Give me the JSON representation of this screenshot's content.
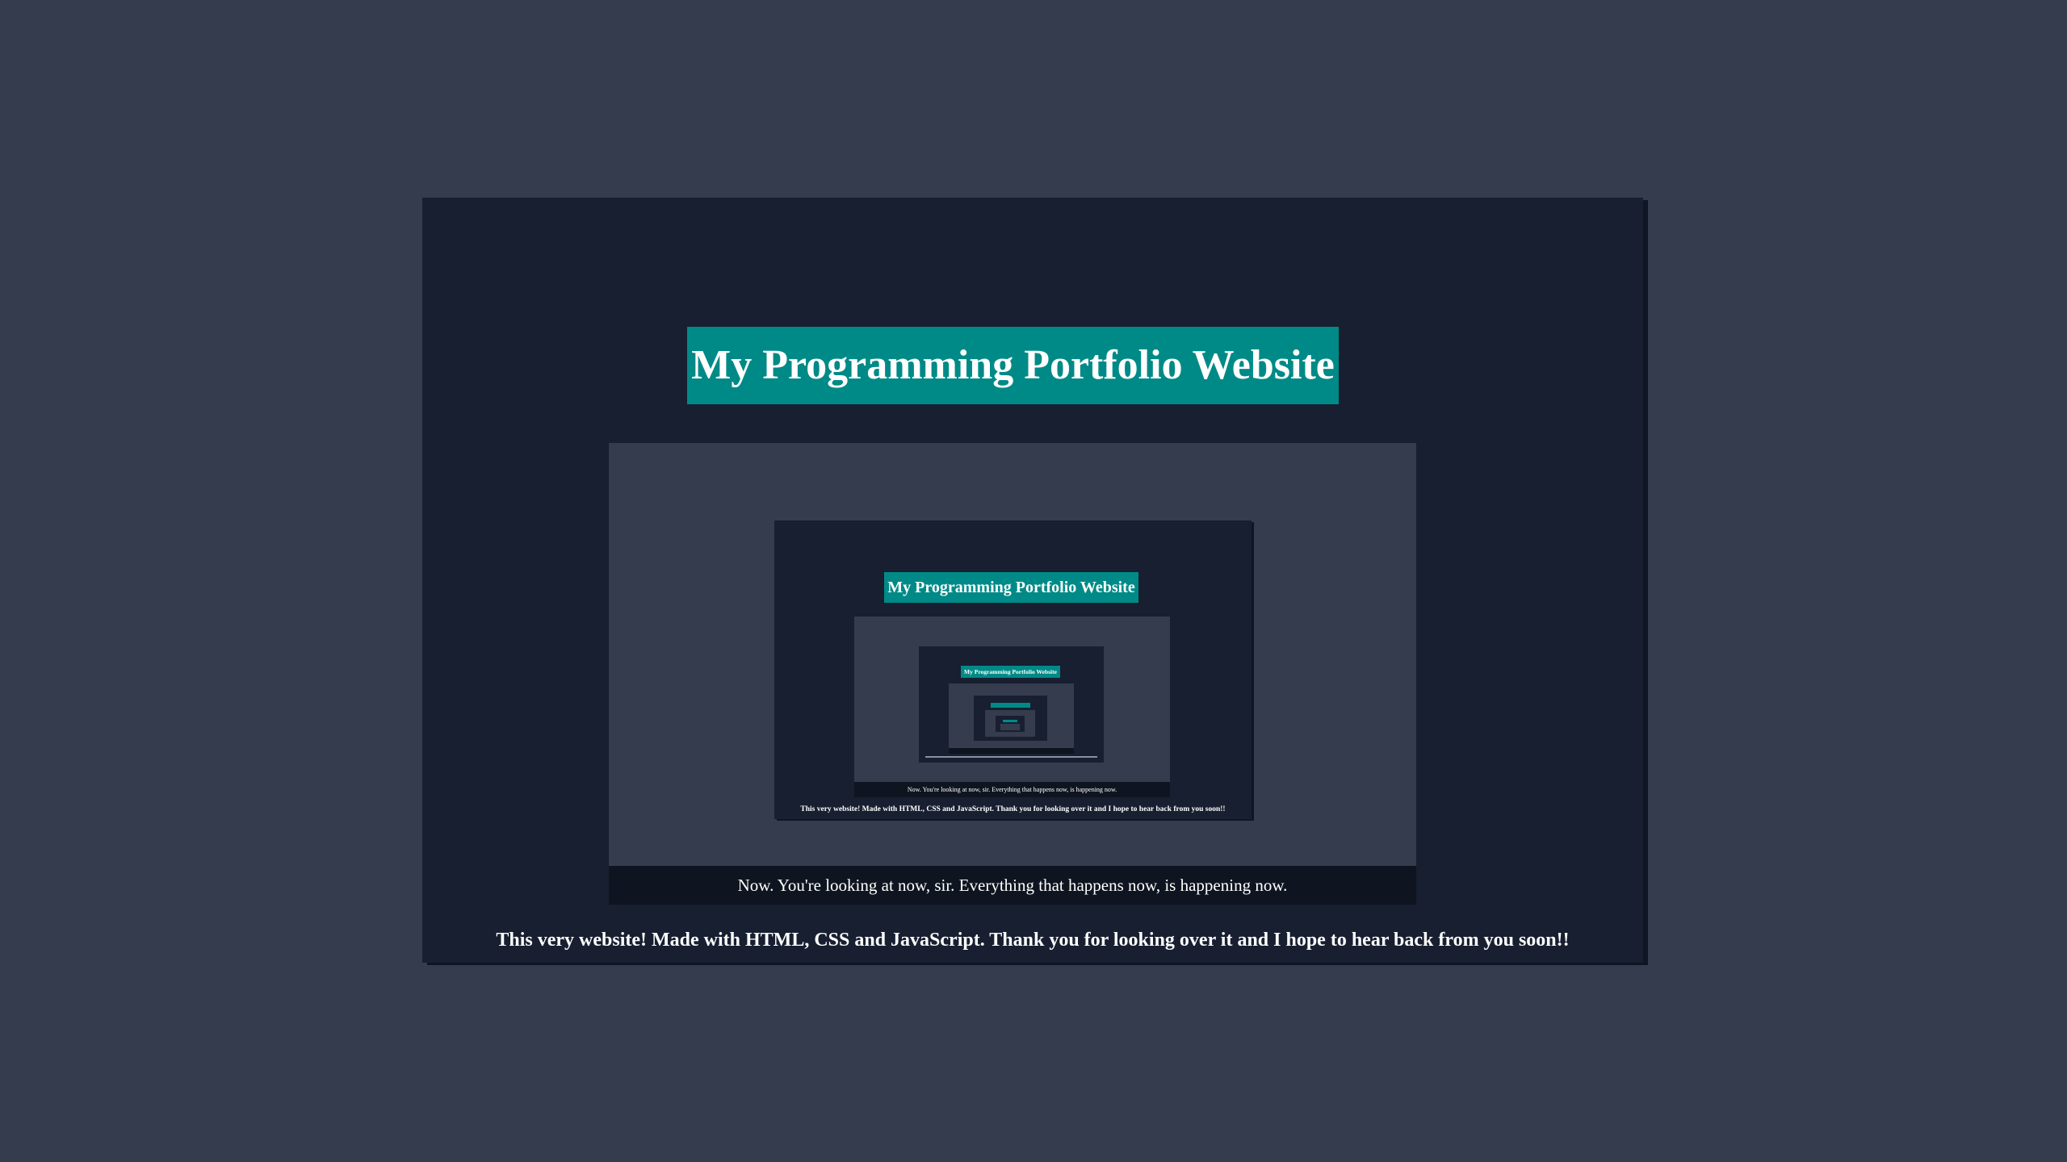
{
  "page": {
    "title": "My Programming Portfolio Website",
    "caption": "Now. You're looking at now, sir. Everything that happens now, is happening now.",
    "footer": "This very website! Made with HTML, CSS and JavaScript. Thank you for looking over it and I hope to hear back from you soon!!"
  },
  "preview": {
    "level1": {
      "title": "My Programming Portfolio Website",
      "caption": "Now. You're looking at now, sir. Everything that happens now, is happening now.",
      "footer": "This very website! Made with HTML, CSS and JavaScript. Thank you for looking over it and I hope to hear back from you soon!!"
    },
    "level2": {
      "title": "My Programming Portfolio Website"
    }
  },
  "colors": {
    "background": "#343c4e",
    "card": "#171f30",
    "accent": "#008a87",
    "caption_bar": "#0f1520",
    "text": "#ffffff"
  }
}
